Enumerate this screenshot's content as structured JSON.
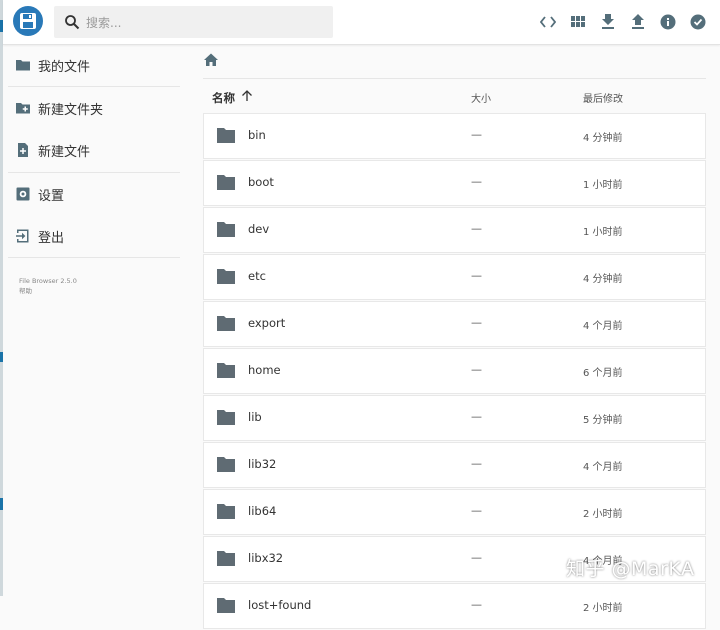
{
  "search": {
    "placeholder": "搜索..."
  },
  "toolbar": {
    "actions": [
      {
        "name": "code-view",
        "icon": "code-icon"
      },
      {
        "name": "grid-view",
        "icon": "grid-icon"
      },
      {
        "name": "download",
        "icon": "download-icon"
      },
      {
        "name": "upload",
        "icon": "upload-icon"
      },
      {
        "name": "info",
        "icon": "info-icon"
      },
      {
        "name": "select",
        "icon": "check-circle-icon"
      }
    ]
  },
  "sidebar": {
    "items": [
      {
        "label": "我的文件",
        "icon": "folder-icon"
      },
      {
        "label": "新建文件夹",
        "icon": "create-folder-icon"
      },
      {
        "label": "新建文件",
        "icon": "note-add-icon"
      },
      {
        "label": "设置",
        "icon": "settings-icon"
      },
      {
        "label": "登出",
        "icon": "logout-icon"
      }
    ],
    "footer": {
      "version": "File Browser 2.5.0",
      "help": "帮助"
    }
  },
  "table": {
    "headers": {
      "name": "名称",
      "size": "大小",
      "modified": "最后修改"
    },
    "rows": [
      {
        "name": "bin",
        "size": "—",
        "modified": "4 分钟前"
      },
      {
        "name": "boot",
        "size": "—",
        "modified": "1 小时前"
      },
      {
        "name": "dev",
        "size": "—",
        "modified": "1 小时前"
      },
      {
        "name": "etc",
        "size": "—",
        "modified": "4 分钟前"
      },
      {
        "name": "export",
        "size": "—",
        "modified": "4 个月前"
      },
      {
        "name": "home",
        "size": "—",
        "modified": "6 个月前"
      },
      {
        "name": "lib",
        "size": "—",
        "modified": "5 分钟前"
      },
      {
        "name": "lib32",
        "size": "—",
        "modified": "4 个月前"
      },
      {
        "name": "lib64",
        "size": "—",
        "modified": "2 小时前"
      },
      {
        "name": "libx32",
        "size": "—",
        "modified": "4 个月前"
      },
      {
        "name": "lost+found",
        "size": "—",
        "modified": "2 小时前"
      }
    ]
  },
  "watermark": "知乎 @MarKA",
  "colors": {
    "accent": "#2979b8",
    "icon": "#546e7a",
    "folder": "#5f6b73"
  }
}
